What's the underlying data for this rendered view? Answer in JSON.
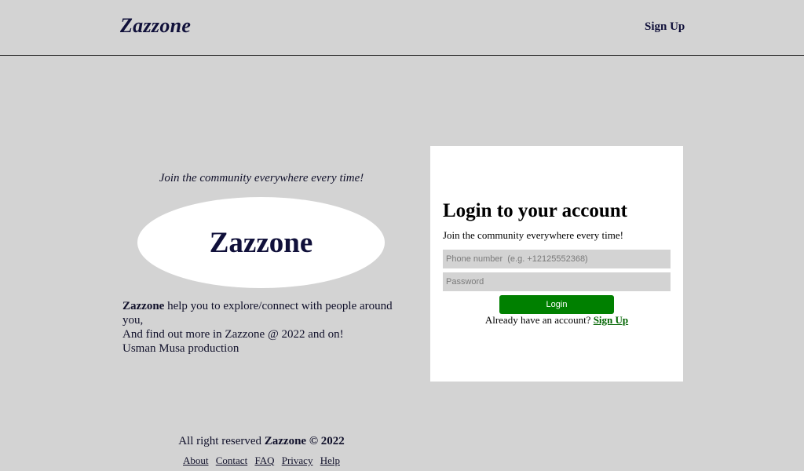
{
  "header": {
    "brand": "Zazzone",
    "signup_label": "Sign Up"
  },
  "hero": {
    "tagline": "Join the community everywhere every time!",
    "logo_text": "Zazzone",
    "about_brand": "Zazzone",
    "about_line1": " help you to explore/connect with people around you,",
    "about_line2": "And find out more in Zazzone @ 2022 and on!",
    "about_line3": "Usman Musa production"
  },
  "login": {
    "title": "Login to your account",
    "subtitle": "Join the community everywhere every time!",
    "phone_placeholder": "Phone number  (e.g. +12125552368)",
    "password_placeholder": "Password",
    "login_button": "Login",
    "already_text": "Already have an account? ",
    "signup_link": "Sign Up"
  },
  "footer": {
    "copyright_prefix": "All right reserved ",
    "copyright_brand": "Zazzone © 2022",
    "links": [
      "About",
      "Contact",
      "FAQ",
      "Privacy",
      "Help"
    ]
  },
  "colors": {
    "background": "#d3d3d3",
    "brand_text": "#10103a",
    "login_button": "#008000",
    "signup_link": "#006400"
  }
}
